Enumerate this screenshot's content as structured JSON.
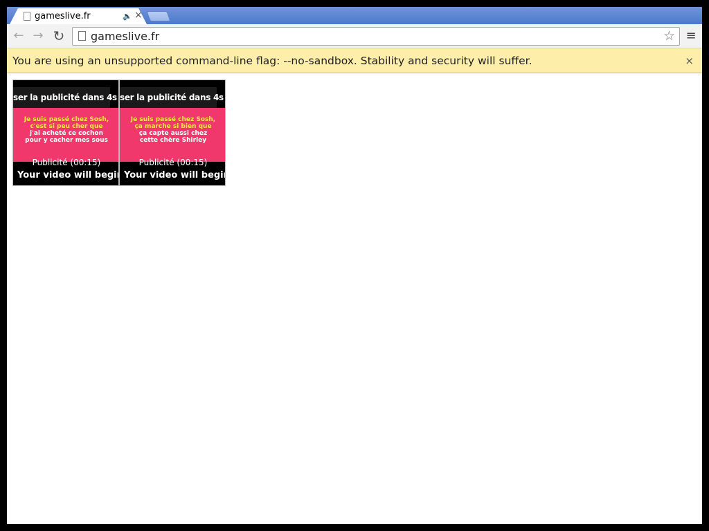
{
  "tab": {
    "title": "gameslive.fr",
    "audio_icon": "speaker-icon",
    "close_icon": "close-icon"
  },
  "toolbar": {
    "url": "gameslive.fr"
  },
  "infobar": {
    "message": "You are using an unsupported command-line flag: --no-sandbox. Stability and security will suffer."
  },
  "players": [
    {
      "skip_text": "ser la publicité dans 4s",
      "ad_lines": [
        "Je suis passé chez Sosh,",
        "c'est si peu cher que",
        "j'ai acheté ce cochon",
        "pour y cacher mes sous"
      ],
      "pub_label": "Publicité   (00:15)",
      "begin_label": "Your video will begin"
    },
    {
      "skip_text": "ser la publicité dans 4s",
      "ad_lines": [
        "Je suis passé chez Sosh,",
        "ça marche si bien que",
        "ça capte aussi chez",
        "cette chère Shirley"
      ],
      "pub_label": "Publicité   (00:15)",
      "begin_label": "Your video will begin"
    }
  ],
  "colors": {
    "tab_strip": "#4d79cc",
    "infobar": "#fdeeaa",
    "ad_pink": "#f0386c",
    "ad_yellow": "#ffe34a"
  }
}
